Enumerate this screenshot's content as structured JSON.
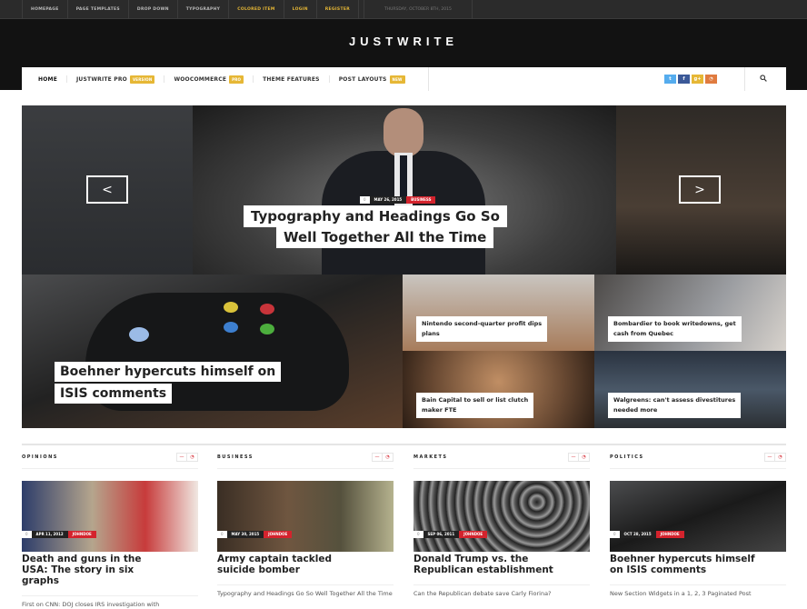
{
  "topbar": {
    "links": [
      {
        "label": "Homepage",
        "color": "#bbbbbb"
      },
      {
        "label": "Page Templates",
        "color": "#bbbbbb"
      },
      {
        "label": "Drop Down",
        "color": "#bbbbbb"
      },
      {
        "label": "Typography",
        "color": "#bbbbbb"
      },
      {
        "label": "Colored Item",
        "color": "#e6b735"
      },
      {
        "label": "Login",
        "color": "#e6b735"
      },
      {
        "label": "Register",
        "color": "#e6b735"
      }
    ],
    "date": "THURSDAY, OCTOBER 8TH, 2015"
  },
  "site": {
    "logo": "JUSTWRITE"
  },
  "nav": {
    "items": [
      {
        "label": "HOME",
        "badge": ""
      },
      {
        "label": "JUSTWRITE PRO",
        "badge": "VERSION"
      },
      {
        "label": "WOOCOMMERCE",
        "badge": "PRO"
      },
      {
        "label": "THEME FEATURES",
        "badge": ""
      },
      {
        "label": "POST LAYOUTS",
        "badge": "NEW"
      }
    ],
    "social": [
      {
        "icon": "twitter-icon",
        "glyph": "t",
        "color": "#55acee"
      },
      {
        "icon": "facebook-icon",
        "glyph": "f",
        "color": "#3b5998"
      },
      {
        "icon": "google-plus-icon",
        "glyph": "g+",
        "color": "#e6b735"
      },
      {
        "icon": "rss-icon",
        "glyph": "◔",
        "color": "#e07b3f"
      }
    ],
    "search_glyph": "⚲"
  },
  "hero": {
    "prev_glyph": "<",
    "next_glyph": ">",
    "comments": "0",
    "date": "MAY 26, 2015",
    "category": "BUSINESS",
    "title_line1": "Typography and Headings Go So",
    "title_line2": "Well Together All the Time"
  },
  "grid": {
    "big": {
      "title_line1": "Boehner hypercuts himself on",
      "title_line2": "ISIS comments"
    },
    "small": [
      {
        "line1": "Nintendo second-quarter profit dips",
        "line2": "plans"
      },
      {
        "line1": "Bombardier to book writedowns, get",
        "line2": "cash from Quebec"
      },
      {
        "line1": "Bain Capital to sell or list clutch",
        "line2": "maker FTE"
      },
      {
        "line1": "Walgreens: can't assess divestitures",
        "line2": "needed more"
      }
    ]
  },
  "sections": [
    {
      "title": "OPINIONS",
      "comments": "0",
      "date": "APR 11, 2012",
      "author": "JOHNDOE",
      "post_title": "Death and guns in the USA: The story in six graphs",
      "sub": "First on CNN: DOJ closes IRS investigation with"
    },
    {
      "title": "BUSINESS",
      "comments": "0",
      "date": "MAY 30, 2015",
      "author": "JOHNDOE",
      "post_title": "Army captain tackled suicide bomber",
      "sub": "Typography and Headings Go So Well Together All the Time"
    },
    {
      "title": "MARKETS",
      "comments": "0",
      "date": "SEP 06, 2011",
      "author": "JOHNDOE",
      "post_title": "Donald Trump vs. the Republican establishment",
      "sub": "Can the Republican debate save Carly Fiorina?"
    },
    {
      "title": "POLITICS",
      "comments": "0",
      "date": "OCT 28, 2015",
      "author": "JOHNDOE",
      "post_title": "Boehner hypercuts himself on ISIS comments",
      "sub": "New Section Widgets in a 1, 2, 3 Paginated Post"
    }
  ],
  "section_controls": {
    "minus_glyph": "—",
    "rss_glyph": "◔"
  },
  "colors": {
    "accent_yellow": "#e6b735",
    "accent_red": "#d4232d",
    "topbar_bg": "#2b2b2b",
    "masthead_bg": "#121212"
  }
}
